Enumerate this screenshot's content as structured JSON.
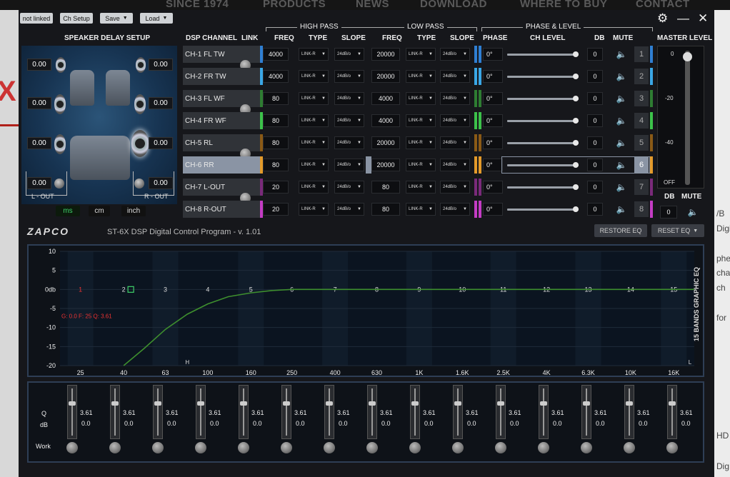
{
  "site": {
    "nav": [
      "SINCE 1974",
      "PRODUCTS",
      "NEWS",
      "DOWNLOAD",
      "WHERE TO BUY",
      "CONTACT"
    ],
    "right_fragments": [
      "/B",
      "Digi",
      "phe",
      "char",
      "ch",
      "for",
      "HD",
      "Dig"
    ]
  },
  "toolbar": {
    "not_linked": "not linked",
    "ch_setup": "Ch Setup",
    "save": "Save",
    "load": "Load"
  },
  "window": {
    "settings_icon": "gear-icon",
    "minimize_icon": "minimize-icon",
    "close_icon": "close-icon"
  },
  "headers": {
    "speaker_delay": "SPEAKER DELAY SETUP",
    "dsp_channel": "DSP CHANNEL",
    "link": "LINK",
    "high_pass": "HIGH PASS",
    "low_pass": "LOW PASS",
    "phase_level": "PHASE & LEVEL",
    "freq": "FREQ",
    "type": "TYPE",
    "slope": "SLOPE",
    "phase": "PHASE",
    "ch_level": "CH LEVEL",
    "db": "DB",
    "mute": "MUTE",
    "master_level": "MASTER LEVEL"
  },
  "delay": {
    "values": [
      "0.00",
      "0.00",
      "0.00",
      "0.00",
      "0.00",
      "0.00"
    ],
    "l_out_value": "0.00",
    "r_out_value": "0.00",
    "l_out_label": "L - OUT",
    "r_out_label": "R - OUT",
    "units": [
      "ms",
      "cm",
      "inch"
    ],
    "selected_unit": "ms"
  },
  "channels": [
    {
      "name": "CH-1 FL TW",
      "hp_freq": "4000",
      "hp_type": "LINK-R",
      "hp_slope": "24dB/o",
      "lp_freq": "20000",
      "lp_type": "LINK-R",
      "lp_slope": "24dB/o",
      "phase": "0°",
      "db": "0",
      "num": "1",
      "color": "#2f7fd3",
      "selected": false
    },
    {
      "name": "CH-2 FR TW",
      "hp_freq": "4000",
      "hp_type": "LINK-R",
      "hp_slope": "24dB/o",
      "lp_freq": "20000",
      "lp_type": "LINK-R",
      "lp_slope": "24dB/o",
      "phase": "0°",
      "db": "0",
      "num": "2",
      "color": "#3aa7e6",
      "selected": false
    },
    {
      "name": "CH-3 FL WF",
      "hp_freq": "80",
      "hp_type": "LINK-R",
      "hp_slope": "24dB/o",
      "lp_freq": "4000",
      "lp_type": "LINK-R",
      "lp_slope": "24dB/o",
      "phase": "0°",
      "db": "0",
      "num": "3",
      "color": "#2e7d32",
      "selected": false
    },
    {
      "name": "CH-4 FR WF",
      "hp_freq": "80",
      "hp_type": "LINK-R",
      "hp_slope": "24dB/o",
      "lp_freq": "4000",
      "lp_type": "LINK-R",
      "lp_slope": "24dB/o",
      "phase": "0°",
      "db": "0",
      "num": "4",
      "color": "#3cc24a",
      "selected": false
    },
    {
      "name": "CH-5 RL",
      "hp_freq": "80",
      "hp_type": "LINK-R",
      "hp_slope": "24dB/o",
      "lp_freq": "20000",
      "lp_type": "LINK-R",
      "lp_slope": "24dB/o",
      "phase": "0°",
      "db": "0",
      "num": "5",
      "color": "#8a5a16",
      "selected": false
    },
    {
      "name": "CH-6 RR",
      "hp_freq": "80",
      "hp_type": "LINK-R",
      "hp_slope": "24dB/o",
      "lp_freq": "20000",
      "lp_type": "LINK-R",
      "lp_slope": "24dB/o",
      "phase": "0°",
      "db": "0",
      "num": "6",
      "color": "#e39a2a",
      "selected": true
    },
    {
      "name": "CH-7 L-OUT",
      "hp_freq": "20",
      "hp_type": "LINK-R",
      "hp_slope": "24dB/o",
      "lp_freq": "80",
      "lp_type": "LINK-R",
      "lp_slope": "24dB/o",
      "phase": "0°",
      "db": "0",
      "num": "7",
      "color": "#7a2a7a",
      "selected": false
    },
    {
      "name": "CH-8 R-OUT",
      "hp_freq": "20",
      "hp_type": "LINK-R",
      "hp_slope": "24dB/o",
      "lp_freq": "80",
      "lp_type": "LINK-R",
      "lp_slope": "24dB/o",
      "phase": "0°",
      "db": "0",
      "num": "8",
      "color": "#c43cc4",
      "selected": false
    }
  ],
  "master": {
    "ticks": [
      "0",
      "-20",
      "-40",
      "OFF"
    ],
    "db_label": "DB",
    "mute_label": "MUTE",
    "db_value": "0",
    "level_fraction": 1.0
  },
  "brand": {
    "logo": "ZAPCO",
    "program_title": "ST-6X DSP Digital Control Program - v. 1.01"
  },
  "eq_buttons": {
    "restore": "RESTORE EQ",
    "reset": "RESET EQ"
  },
  "eq": {
    "side_title": "15 BANDS GRAPHIC EQ",
    "y_ticks": [
      "10",
      "5",
      "0db",
      "-5",
      "-10",
      "-15",
      "-20"
    ],
    "x_ticks": [
      "25",
      "40",
      "63",
      "100",
      "160",
      "250",
      "400",
      "630",
      "1K",
      "1.6K",
      "2.5K",
      "4K",
      "6.3K",
      "10K",
      "16K"
    ],
    "band_numbers": [
      "1",
      "2",
      "3",
      "4",
      "5",
      "6",
      "7",
      "8",
      "9",
      "10",
      "11",
      "12",
      "13",
      "14",
      "15"
    ],
    "selected_band": 2,
    "info_text": "G: 0.0  F: 25  Q: 3.61",
    "h_marker": "H",
    "l_marker": "L"
  },
  "chart_data": {
    "type": "line",
    "title": "",
    "xlabel": "",
    "ylabel": "",
    "x_log_scale": true,
    "x": [
      40,
      50,
      63,
      80,
      100,
      125,
      160,
      200,
      250,
      400,
      630,
      1000,
      1600,
      2500,
      4000,
      6300,
      10000,
      16000,
      20000
    ],
    "y": [
      -20,
      -15.5,
      -10.5,
      -6.5,
      -3.8,
      -1.9,
      -0.9,
      -0.3,
      0,
      0,
      0,
      0,
      0,
      0,
      0,
      0,
      0,
      0,
      0
    ],
    "xlim": [
      25,
      20000
    ],
    "ylim": [
      -20,
      10
    ],
    "grid": true,
    "curve_color": "#3e8f2e"
  },
  "bands": {
    "q_label": "Q",
    "db_label": "dB",
    "work_label": "Work",
    "q_values": [
      "3.61",
      "3.61",
      "3.61",
      "3.61",
      "3.61",
      "3.61",
      "3.61",
      "3.61",
      "3.61",
      "3.61",
      "3.61",
      "3.61",
      "3.61",
      "3.61",
      "3.61"
    ],
    "db_values": [
      "0.0",
      "0.0",
      "0.0",
      "0.0",
      "0.0",
      "0.0",
      "0.0",
      "0.0",
      "0.0",
      "0.0",
      "0.0",
      "0.0",
      "0.0",
      "0.0",
      "0.0"
    ]
  }
}
